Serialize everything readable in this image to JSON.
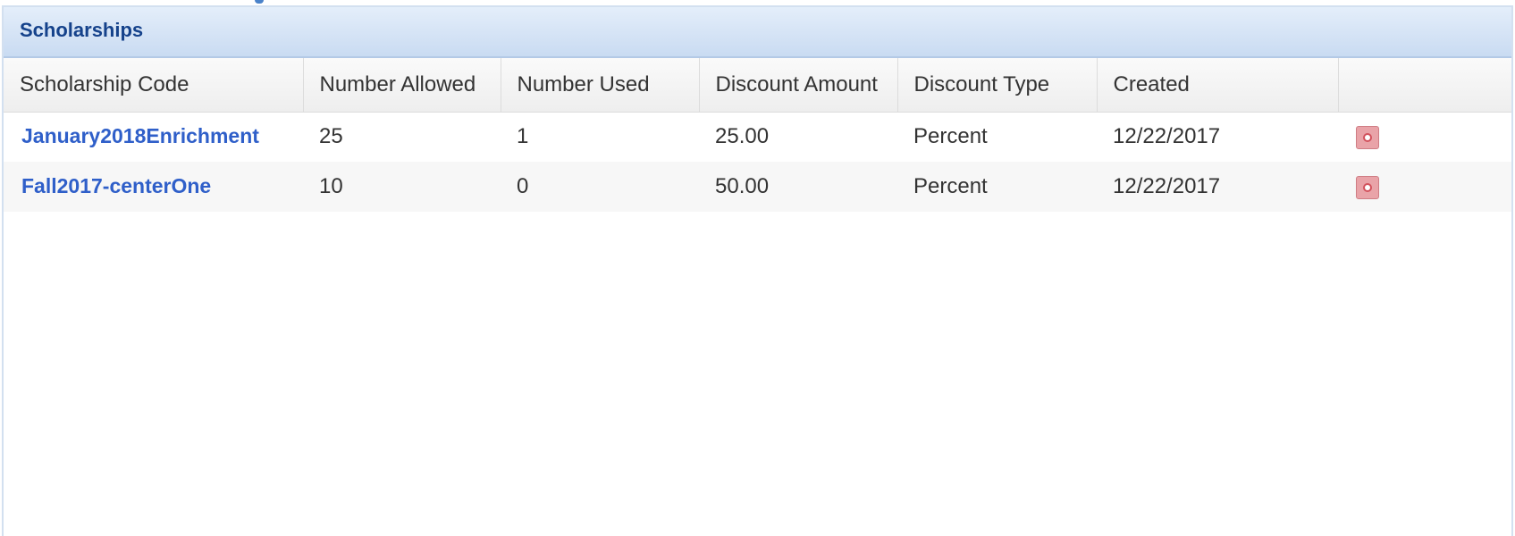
{
  "panel": {
    "title": "Scholarships"
  },
  "table": {
    "columns": [
      "Scholarship Code",
      "Number Allowed",
      "Number Used",
      "Discount Amount",
      "Discount Type",
      "Created",
      ""
    ],
    "rows": [
      {
        "code": "January2018Enrichment",
        "number_allowed": "25",
        "number_used": "1",
        "discount_amount": "25.00",
        "discount_type": "Percent",
        "created": "12/22/2017",
        "action_icon": "delete-icon"
      },
      {
        "code": "Fall2017-centerOne",
        "number_allowed": "10",
        "number_used": "0",
        "discount_amount": "50.00",
        "discount_type": "Percent",
        "created": "12/22/2017",
        "action_icon": "delete-icon"
      }
    ]
  },
  "colors": {
    "header_bg": "#c9dbf2",
    "title_text": "#15428b",
    "link": "#2f5fc9",
    "delete_icon": "#e9a3a8"
  }
}
